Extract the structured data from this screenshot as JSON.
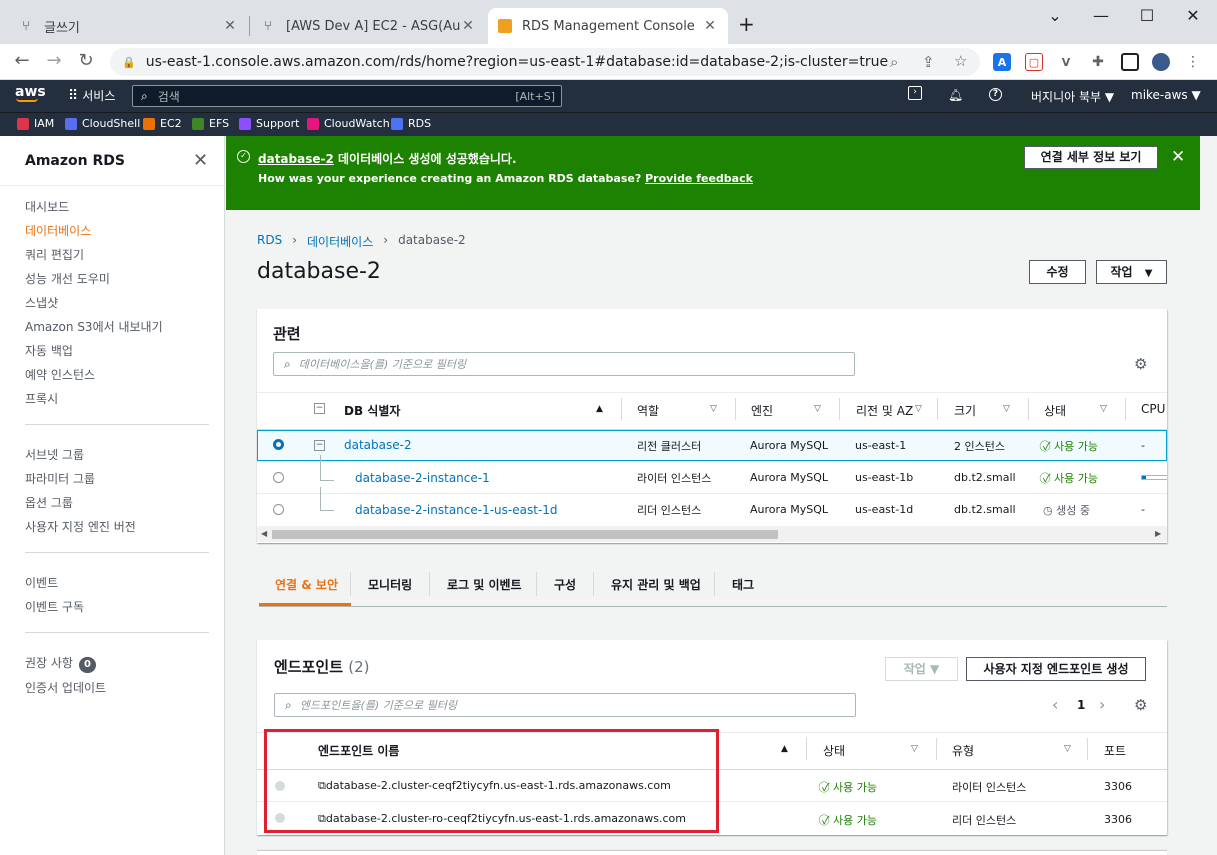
{
  "browser": {
    "tabs": [
      {
        "title": "글쓰기",
        "icon": "git-icon"
      },
      {
        "title": "[AWS Dev A] EC2 - ASG(Augo S",
        "icon": "git-icon"
      },
      {
        "title": "RDS Management Console",
        "icon": "aws-box-icon"
      }
    ],
    "new_tab": "+",
    "url": "us-east-1.console.aws.amazon.com/rds/home?region=us-east-1#database:id=database-2;is-cluster=true"
  },
  "aws_nav": {
    "logo": "aws",
    "services": "서비스",
    "search_placeholder": "검색",
    "search_shortcut": "[Alt+S]",
    "region": "버지니아 북부 ▼",
    "user": "mike-aws ▼",
    "favorites": [
      {
        "label": "IAM",
        "color": "#dd344c"
      },
      {
        "label": "CloudShell",
        "color": "#5a6cf0"
      },
      {
        "label": "EC2",
        "color": "#ed7100"
      },
      {
        "label": "EFS",
        "color": "#3f8624"
      },
      {
        "label": "Support",
        "color": "#8c4fff"
      },
      {
        "label": "CloudWatch",
        "color": "#e7157b"
      },
      {
        "label": "RDS",
        "color": "#4d72f3"
      }
    ]
  },
  "sidebar": {
    "title": "Amazon RDS",
    "group1": [
      "대시보드",
      "데이터베이스",
      "쿼리 편집기",
      "성능 개선 도우미",
      "스냅샷",
      "Amazon S3에서 내보내기",
      "자동 백업",
      "예약 인스턴스",
      "프록시"
    ],
    "group2": [
      "서브넷 그룹",
      "파라미터 그룹",
      "옵션 그룹",
      "사용자 지정 엔진 버전"
    ],
    "group3": [
      "이벤트",
      "이벤트 구독"
    ],
    "group4_item1": "권장 사항",
    "group4_badge": "0",
    "group4_item2": "인증서 업데이트"
  },
  "flash": {
    "db_link": "database-2",
    "title_rest": " 데이터베이스 생성에 성공했습니다.",
    "sub": "How was your experience creating an Amazon RDS database?",
    "feedback": "Provide feedback",
    "button": "연결 세부 정보 보기"
  },
  "breadcrumb": {
    "rds": "RDS",
    "databases": "데이터베이스",
    "current": "database-2"
  },
  "page": {
    "title": "database-2",
    "modify": "수정",
    "actions": "작업"
  },
  "related": {
    "title": "관련",
    "filter_placeholder": "데이터베이스을(를) 기준으로 필터링",
    "headers": [
      "DB 식별자",
      "역할",
      "엔진",
      "리전 및 AZ",
      "크기",
      "상태",
      "CPU"
    ],
    "rows": [
      {
        "id": "database-2",
        "role": "리전 클러스터",
        "engine": "Aurora MySQL",
        "region": "us-east-1",
        "size": "2 인스턴스",
        "status": "사용 가능",
        "cpu": "-"
      },
      {
        "id": "database-2-instance-1",
        "role": "라이터 인스턴스",
        "engine": "Aurora MySQL",
        "region": "us-east-1b",
        "size": "db.t2.small",
        "status": "사용 가능",
        "cpu": ""
      },
      {
        "id": "database-2-instance-1-us-east-1d",
        "role": "리더 인스턴스",
        "engine": "Aurora MySQL",
        "region": "us-east-1d",
        "size": "db.t2.small",
        "status": "생성 중",
        "cpu": "-"
      }
    ]
  },
  "tabs": [
    "연결 & 보안",
    "모니터링",
    "로그 및 이벤트",
    "구성",
    "유지 관리 및 백업",
    "태그"
  ],
  "endpoints": {
    "title": "엔드포인트",
    "count": "(2)",
    "actions": "작업 ▼",
    "create": "사용자 지정 엔드포인트 생성",
    "filter_placeholder": "엔드포인트을(를) 기준으로 필터링",
    "page": "1",
    "headers": [
      "엔드포인트 이름",
      "상태",
      "유형",
      "포트"
    ],
    "rows": [
      {
        "name": "database-2.cluster-ceqf2tiycyfn.us-east-1.rds.amazonaws.com",
        "status": "사용 가능",
        "type": "라이터 인스턴스",
        "port": "3306"
      },
      {
        "name": "database-2.cluster-ro-ceqf2tiycyfn.us-east-1.rds.amazonaws.com",
        "status": "사용 가능",
        "type": "리더 인스턴스",
        "port": "3306"
      }
    ]
  },
  "colors": {
    "success": "#1d8102",
    "link": "#0073bb",
    "active": "#ec7211",
    "highlight": "#e02030",
    "nav": "#232f3e"
  }
}
